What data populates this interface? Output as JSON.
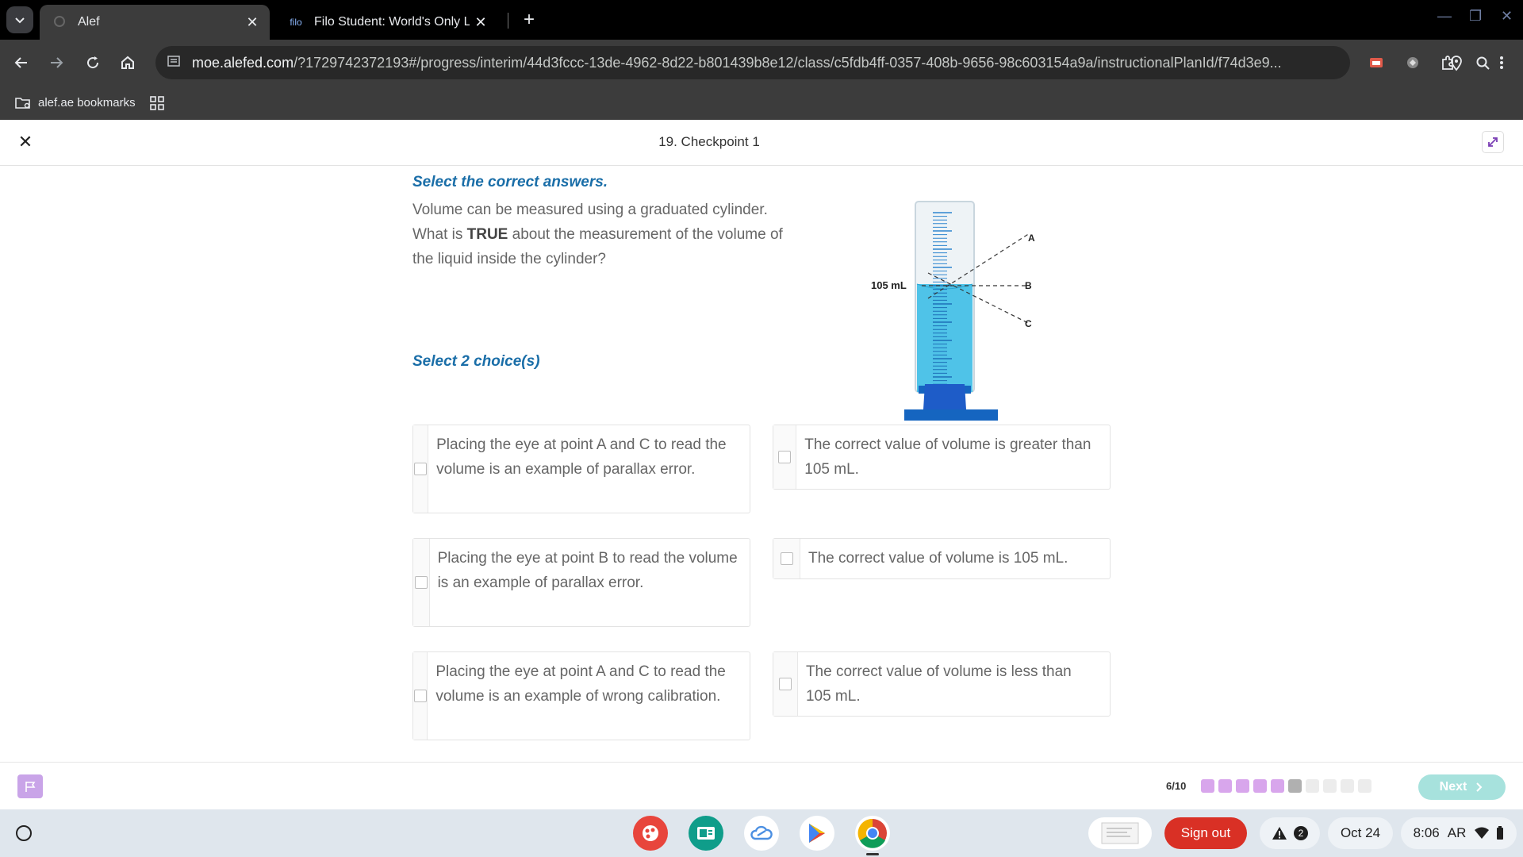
{
  "browser": {
    "tabs": [
      {
        "title": "Alef",
        "active": true
      },
      {
        "title": "Filo Student: World's Only Live I",
        "favicon_text": "filo",
        "active": false
      }
    ],
    "url_domain": "moe.alefed.com",
    "url_rest": "/?1729742372193#/progress/interim/44d3fccc-13de-4962-8d22-b801439b8e12/class/c5fdb4ff-0357-408b-9656-98c603154a9a/instructionalPlanId/f74d3e9...",
    "bookmarks": [
      {
        "label": "alef.ae bookmarks"
      }
    ]
  },
  "header": {
    "title": "19. Checkpoint 1"
  },
  "question": {
    "instruction": "Select the correct answers.",
    "line1": "Volume can be measured using a graduated cylinder.",
    "line2_pre": "What is ",
    "line2_bold": "TRUE",
    "line2_post": " about the measurement of the volume of the liquid inside the cylinder?",
    "select_count": "Select 2 choice(s)"
  },
  "figure": {
    "volume_label": "105 mL",
    "point_a": "A",
    "point_b": "B",
    "point_c": "C",
    "liquid_color": "#4fc3e8",
    "base_color": "#1565c0"
  },
  "choices": [
    {
      "text": "Placing the eye at point A and C to read the volume is an example of parallax error.",
      "checked": false
    },
    {
      "text": "The correct value of volume is greater than 105 mL.",
      "checked": false
    },
    {
      "text": "Placing the eye at point B to read the volume is an example of parallax error.",
      "checked": false
    },
    {
      "text": "The correct value of volume is 105 mL.",
      "checked": false
    },
    {
      "text": "Placing the eye at point A and C to read the volume is an example of wrong calibration.",
      "checked": false
    },
    {
      "text": "The correct value of volume is less than 105 mL.",
      "checked": false
    }
  ],
  "footer": {
    "progress": "6/10",
    "completed_dots": 5,
    "current_dot": 6,
    "total_dots": 10,
    "next_label": "Next",
    "accent_done": "#d8a6ec",
    "accent_current": "#b0b0b0",
    "accent_todo": "#ececec"
  },
  "shelf": {
    "signout_label": "Sign out",
    "notification_count": "2",
    "date": "Oct 24",
    "time": "8:06",
    "ime": "AR"
  }
}
